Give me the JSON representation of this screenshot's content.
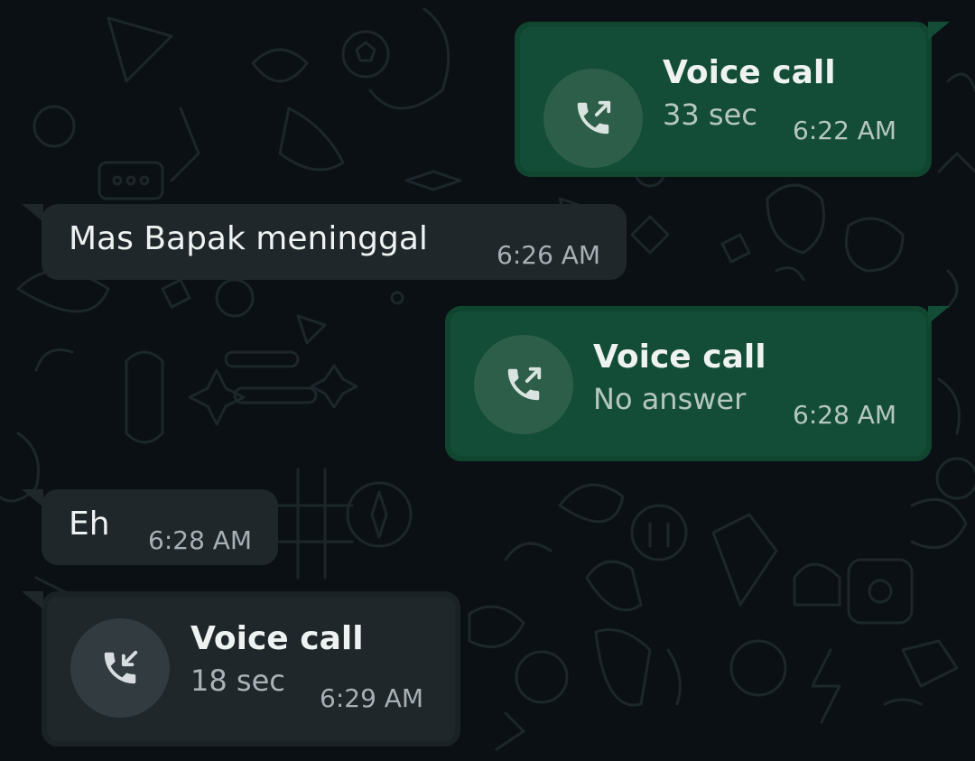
{
  "messages": [
    {
      "type": "call",
      "direction": "outgoing",
      "title": "Voice call",
      "detail": "33 sec",
      "time": "6:22 AM",
      "icon": "phone-outgoing-icon"
    },
    {
      "type": "text",
      "direction": "incoming",
      "text": "Mas Bapak meninggal",
      "time": "6:26 AM"
    },
    {
      "type": "call",
      "direction": "outgoing",
      "title": "Voice call",
      "detail": "No answer",
      "time": "6:28 AM",
      "icon": "phone-outgoing-icon"
    },
    {
      "type": "text",
      "direction": "incoming",
      "text": "Eh",
      "time": "6:28 AM"
    },
    {
      "type": "call",
      "direction": "incoming",
      "title": "Voice call",
      "detail": "18 sec",
      "time": "6:29 AM",
      "icon": "phone-incoming-icon"
    }
  ],
  "colors": {
    "background": "#0b1014",
    "outgoing_bubble": "#144d37",
    "incoming_bubble": "#1f272b",
    "doodle": "#1e272b"
  }
}
